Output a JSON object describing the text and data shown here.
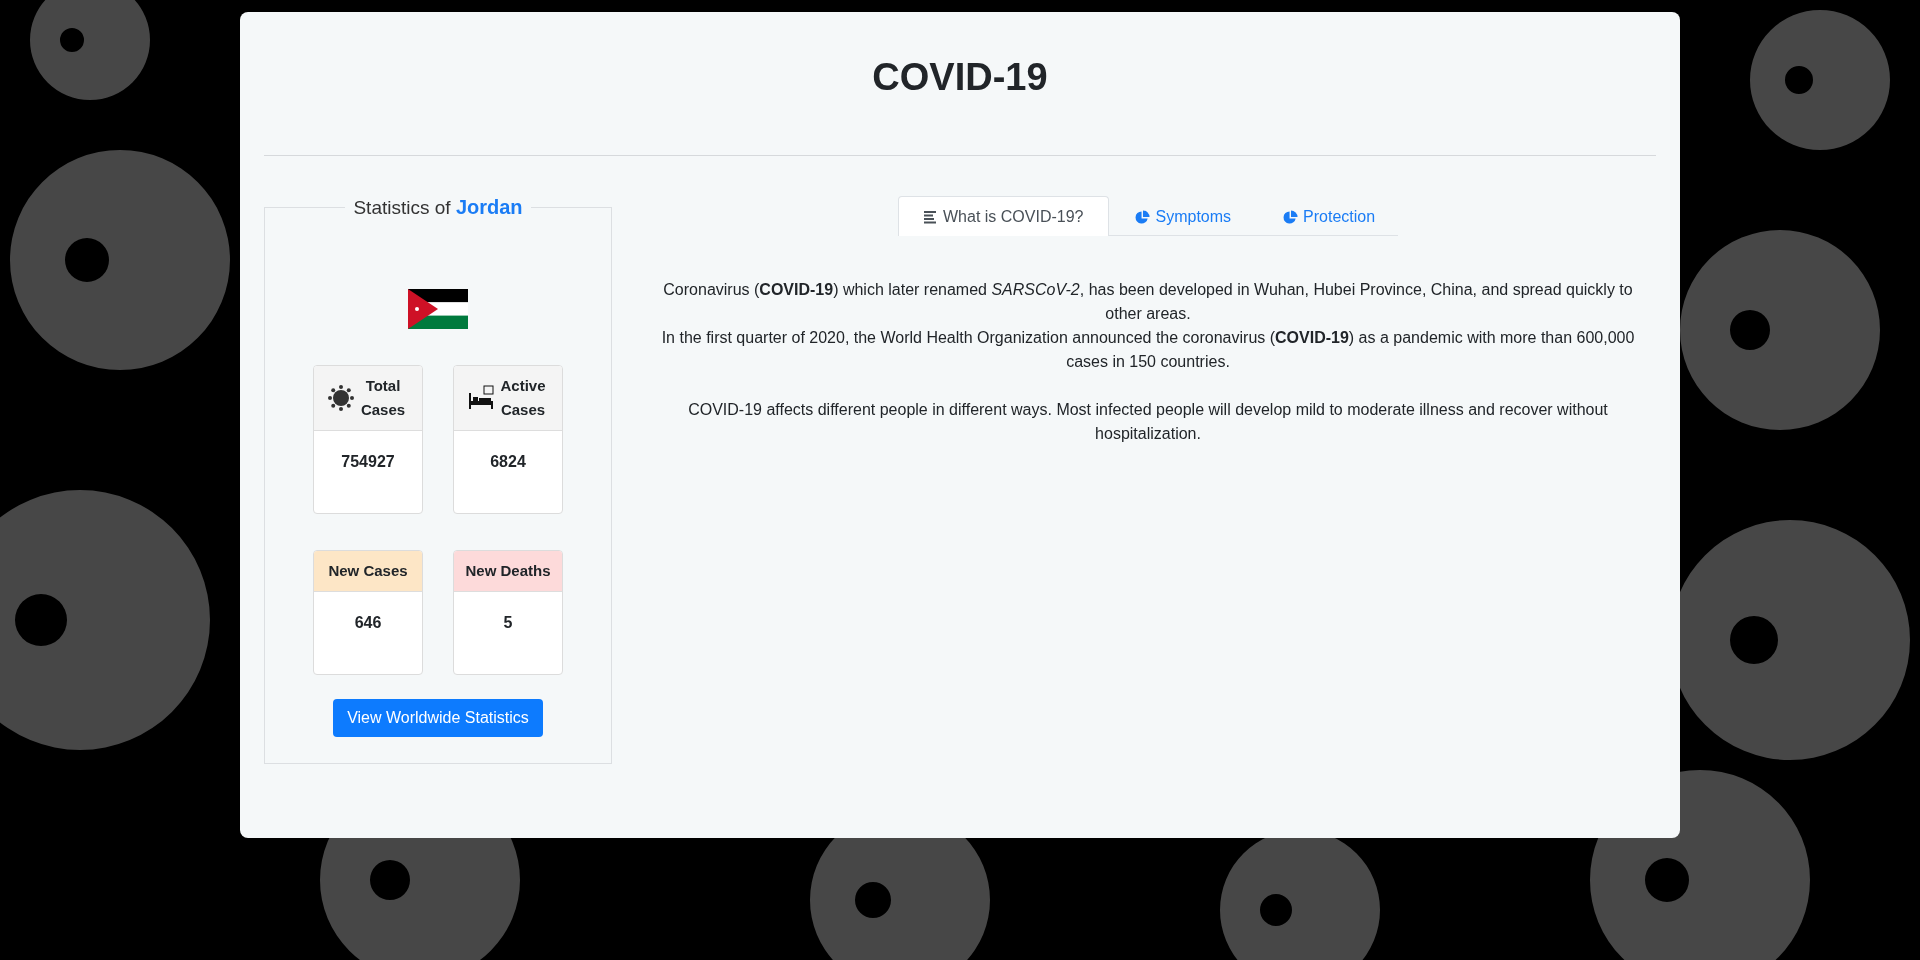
{
  "title": "COVID-19",
  "stats_panel": {
    "legend_prefix": "Statistics of",
    "country": "Jordan",
    "cards": [
      {
        "kind": "virus",
        "label": "Total Cases",
        "value": "754927",
        "color": "#f4f4f4"
      },
      {
        "kind": "bed",
        "label": "Active Cases",
        "value": "6824",
        "color": "#f4f4f4"
      },
      {
        "kind": "plain",
        "label": "New Cases",
        "value": "646",
        "color": "#fde6c6"
      },
      {
        "kind": "plain",
        "label": "New Deaths",
        "value": "5",
        "color": "#fddada"
      }
    ],
    "button": "View Worldwide Statistics"
  },
  "tabs": [
    {
      "kind": "lines",
      "label": "What is COVID-19?",
      "selected": true
    },
    {
      "kind": "pie",
      "label": "Symptoms",
      "selected": false
    },
    {
      "kind": "pie",
      "label": "Protection",
      "selected": false
    }
  ],
  "content": [
    {
      "lines": [
        "Coronavirus (**COVID-19**) which later renamed *SARSCoV-2*, has been developed in Wuhan, Hubei Province, China, and spread quickly to other areas.",
        "In the first quarter of 2020, the World Health Organization announced the coronavirus (**COVID-19**) as a pandemic with more than 600,000 cases in 150 countries."
      ]
    },
    {
      "lines": [
        "COVID-19 affects different people in different ways. Most infected people will develop mild to moderate illness and recover without hospitalization."
      ]
    }
  ]
}
